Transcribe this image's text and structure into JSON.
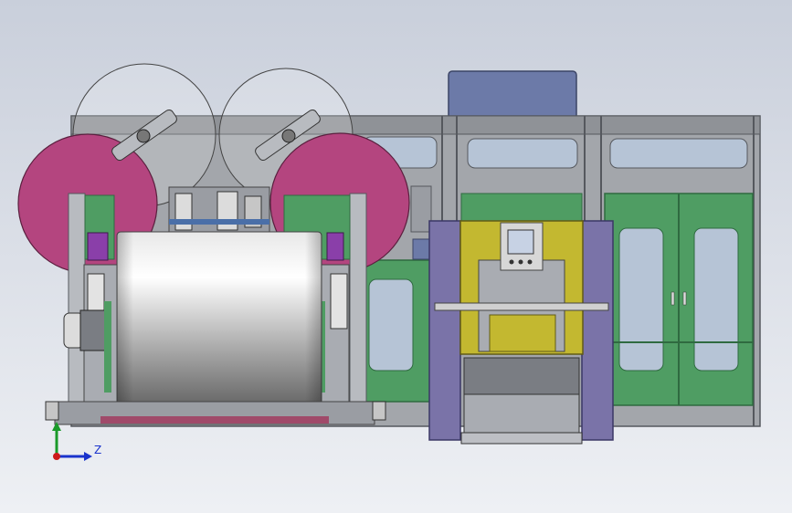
{
  "viewport": {
    "background_top": "#c9cfdb",
    "background_bottom": "#eef0f4"
  },
  "model": {
    "colors": {
      "frame": "#9a9da3",
      "frame_dark": "#5d6066",
      "panel_window": "#b6c4d6",
      "cabinet_green": "#4f9d63",
      "cabinet_green_dark": "#2f6a40",
      "reel_magenta": "#b4457f",
      "reel_ghost": "#ffffff",
      "roll_light": "#f2f2f2",
      "roll_dark": "#6c6c6c",
      "press_purple": "#7a73a8",
      "press_yellow": "#c3b830",
      "motor_blue": "#6c7aa8",
      "accent_purple": "#8a3fa9",
      "base_red": "#a04a6a"
    }
  },
  "triad": {
    "z_label": "Z",
    "x_color": "#1a33cc",
    "y_color": "#1a9a2a",
    "origin_color": "#cc1a1a"
  }
}
